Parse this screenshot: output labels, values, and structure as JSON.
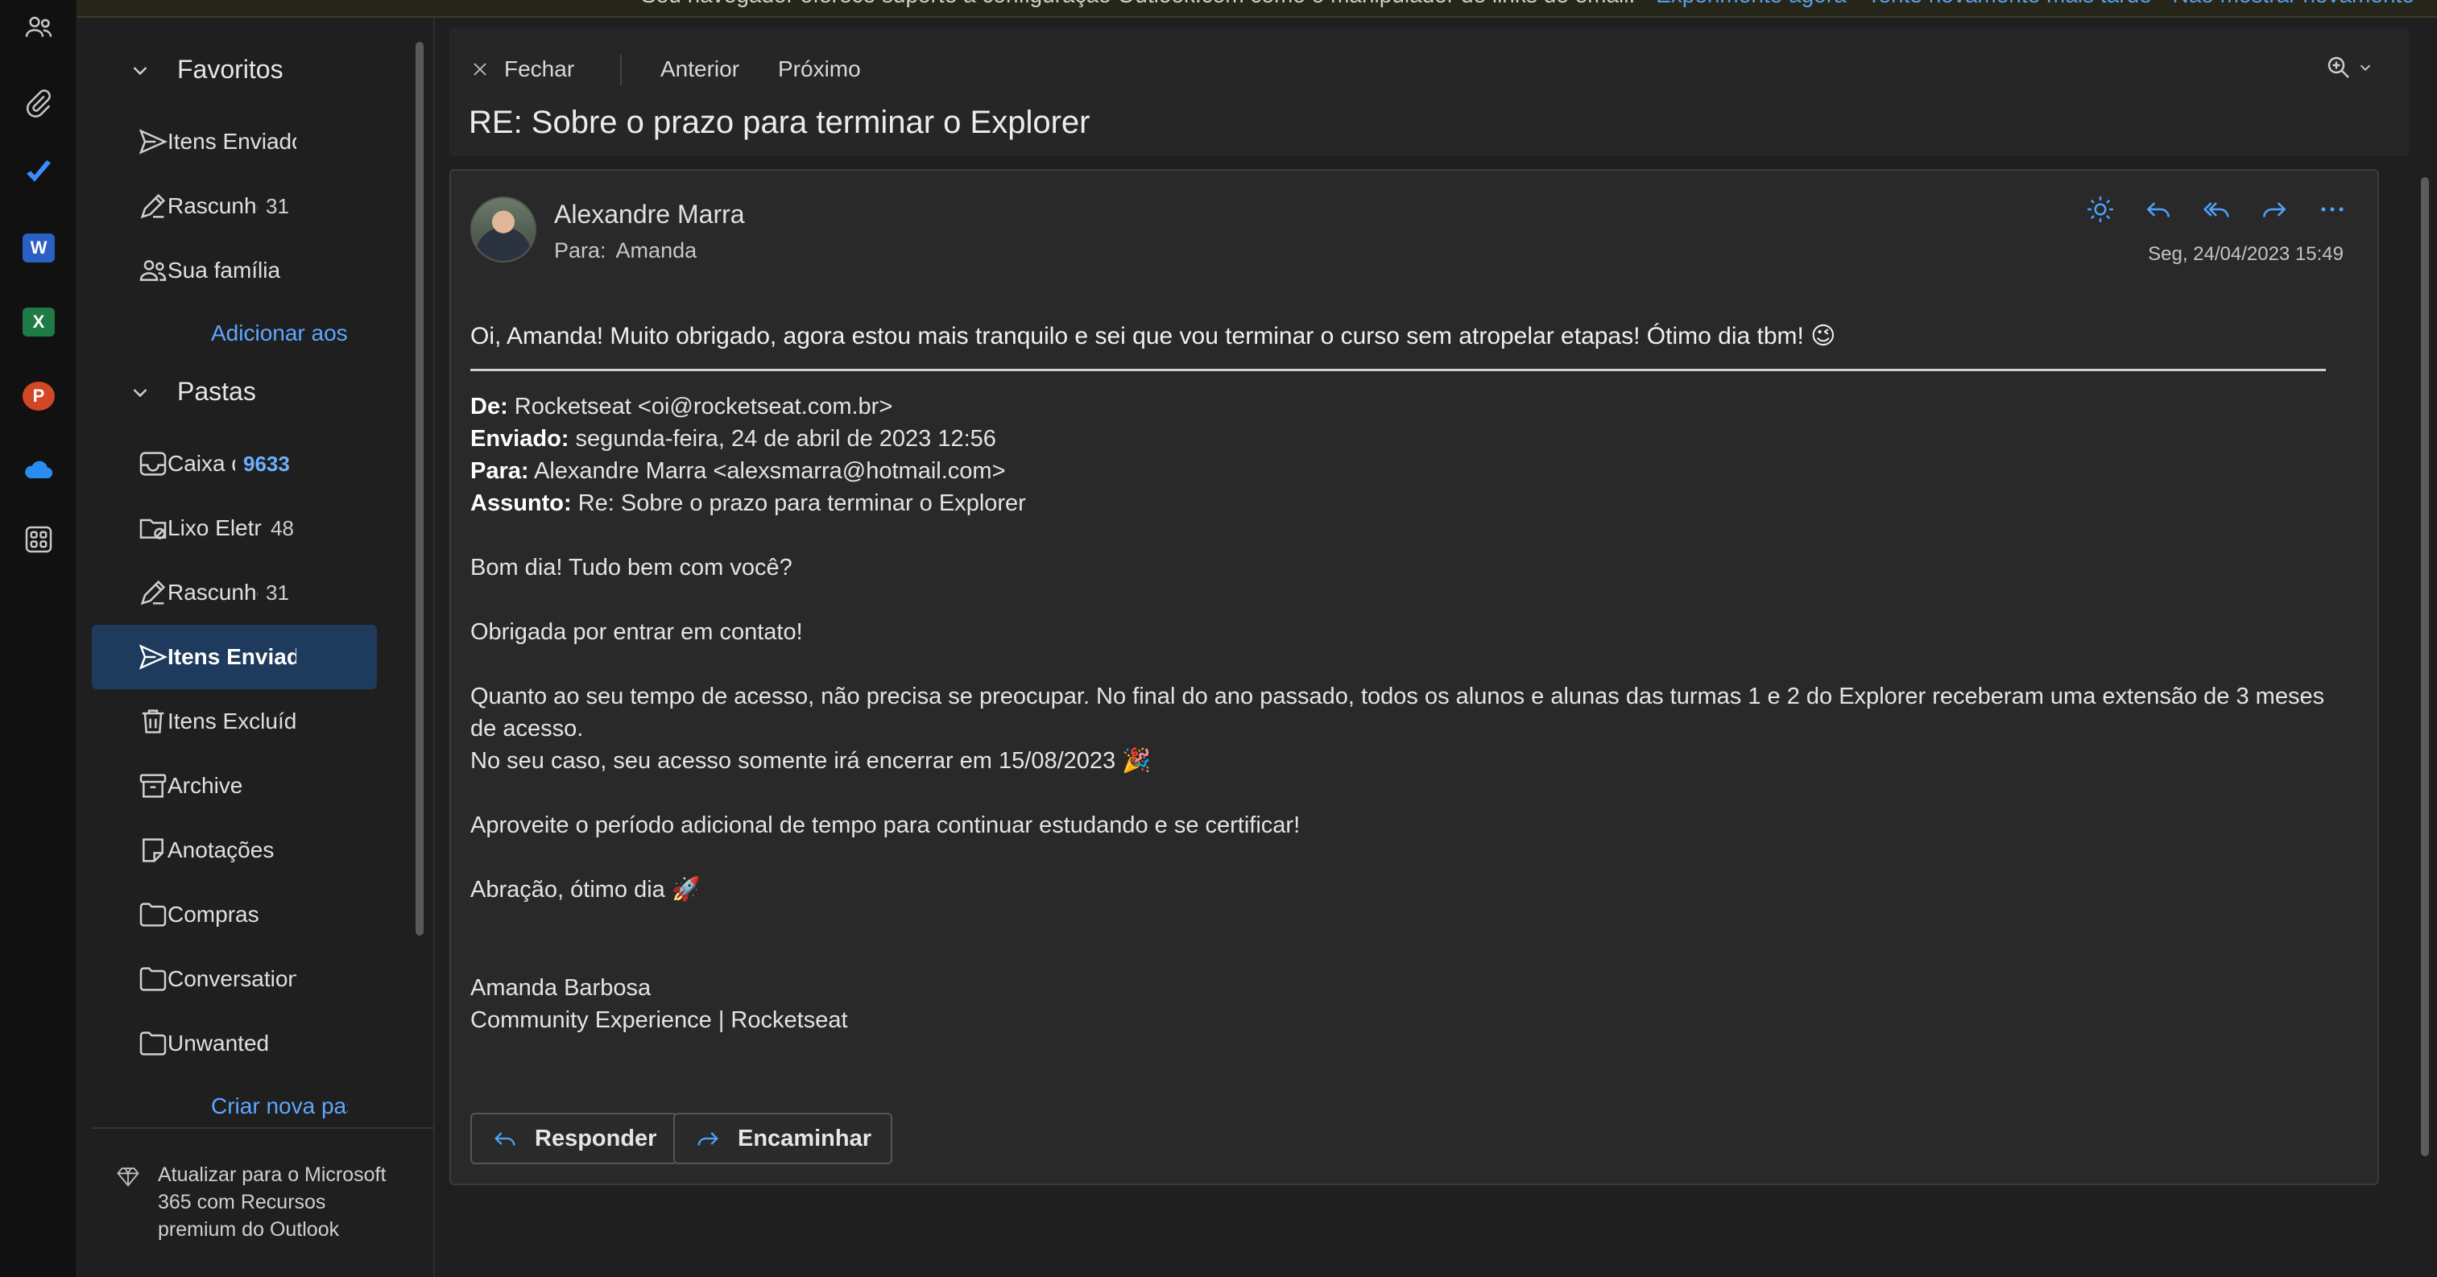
{
  "banner": {
    "text": "Seu navegador oferece suporte à configuração Outlook.com como o manipulador de links de email.",
    "links": [
      "Experimente agora",
      "Tente novamente mais tarde",
      "Não mostrar novamente"
    ]
  },
  "rail": {
    "apps": [
      "people-icon",
      "attachment-icon",
      "todo-icon",
      "word-icon",
      "excel-icon",
      "powerpoint-icon",
      "onedrive-icon",
      "apps-icon"
    ],
    "word_letter": "W",
    "excel_letter": "X",
    "powerpoint_letter": "P"
  },
  "favorites": {
    "title": "Favoritos",
    "items": [
      {
        "label": "Itens Enviados",
        "count": ""
      },
      {
        "label": "Rascunhos",
        "count": "31"
      },
      {
        "label": "Sua família",
        "count": ""
      }
    ],
    "add_link": "Adicionar aos favoritos"
  },
  "folders": {
    "title": "Pastas",
    "items": [
      {
        "label": "Caixa de Entrada",
        "count": "9633"
      },
      {
        "label": "Lixo Eletrônico",
        "count": "48"
      },
      {
        "label": "Rascunhos",
        "count": "31"
      },
      {
        "label": "Itens Enviados",
        "count": ""
      },
      {
        "label": "Itens Excluídos",
        "count": ""
      },
      {
        "label": "Archive",
        "count": ""
      },
      {
        "label": "Anotações",
        "count": ""
      },
      {
        "label": "Compras",
        "count": ""
      },
      {
        "label": "Conversation History",
        "count": ""
      },
      {
        "label": "Unwanted",
        "count": ""
      }
    ],
    "new_link": "Criar nova pasta",
    "selected": "Itens Enviados"
  },
  "upgrade": {
    "text": "Atualizar para o Microsoft 365 com Recursos premium do Outlook"
  },
  "toolbar": {
    "close": "Fechar",
    "previous": "Anterior",
    "next": "Próximo"
  },
  "message": {
    "subject": "RE: Sobre o prazo para terminar o Explorer",
    "sender": "Alexandre Marra",
    "to_label": "Para:",
    "to": "Amanda",
    "date": "Seg, 24/04/2023 15:49",
    "reply_text": "Oi, Amanda! Muito obrigado, agora estou mais tranquilo e sei que vou terminar o curso sem atropelar etapas! Ótimo dia tbm! 😉",
    "quoted_header": {
      "from_label": "De:",
      "from": "Rocketseat <oi@rocketseat.com.br>",
      "sent_label": "Enviado:",
      "sent": "segunda-feira, 24 de abril de 2023 12:56",
      "to_label": "Para:",
      "to": "Alexandre Marra <alexsmarra@hotmail.com>",
      "subject_label": "Assunto:",
      "subject": "Re: Sobre o prazo para terminar o Explorer"
    },
    "quoted_body": {
      "greeting": "Bom dia! Tudo bem com você?",
      "thanks": "Obrigada por entrar em contato!",
      "paragraph": "Quanto ao seu tempo de acesso, não precisa se preocupar. No final do ano passado, todos os alunos e alunas das turmas 1 e 2 do Explorer receberam uma extensão de 3 meses de acesso.",
      "deadline": "No seu caso, seu acesso somente irá encerrar em 15/08/2023 🎉",
      "advice": "Aproveite o período adicional de tempo para continuar estudando e se certificar!",
      "closing": "Abração, ótimo dia 🚀",
      "sig_name": "Amanda Barbosa",
      "sig_role": "Community Experience | Rocketseat"
    },
    "reply_button": "Responder",
    "forward_button": "Encaminhar"
  },
  "colors": {
    "accent": "#5ea7ff",
    "selected_bg": "#1e3a5c",
    "background": "#1f1f1f"
  }
}
